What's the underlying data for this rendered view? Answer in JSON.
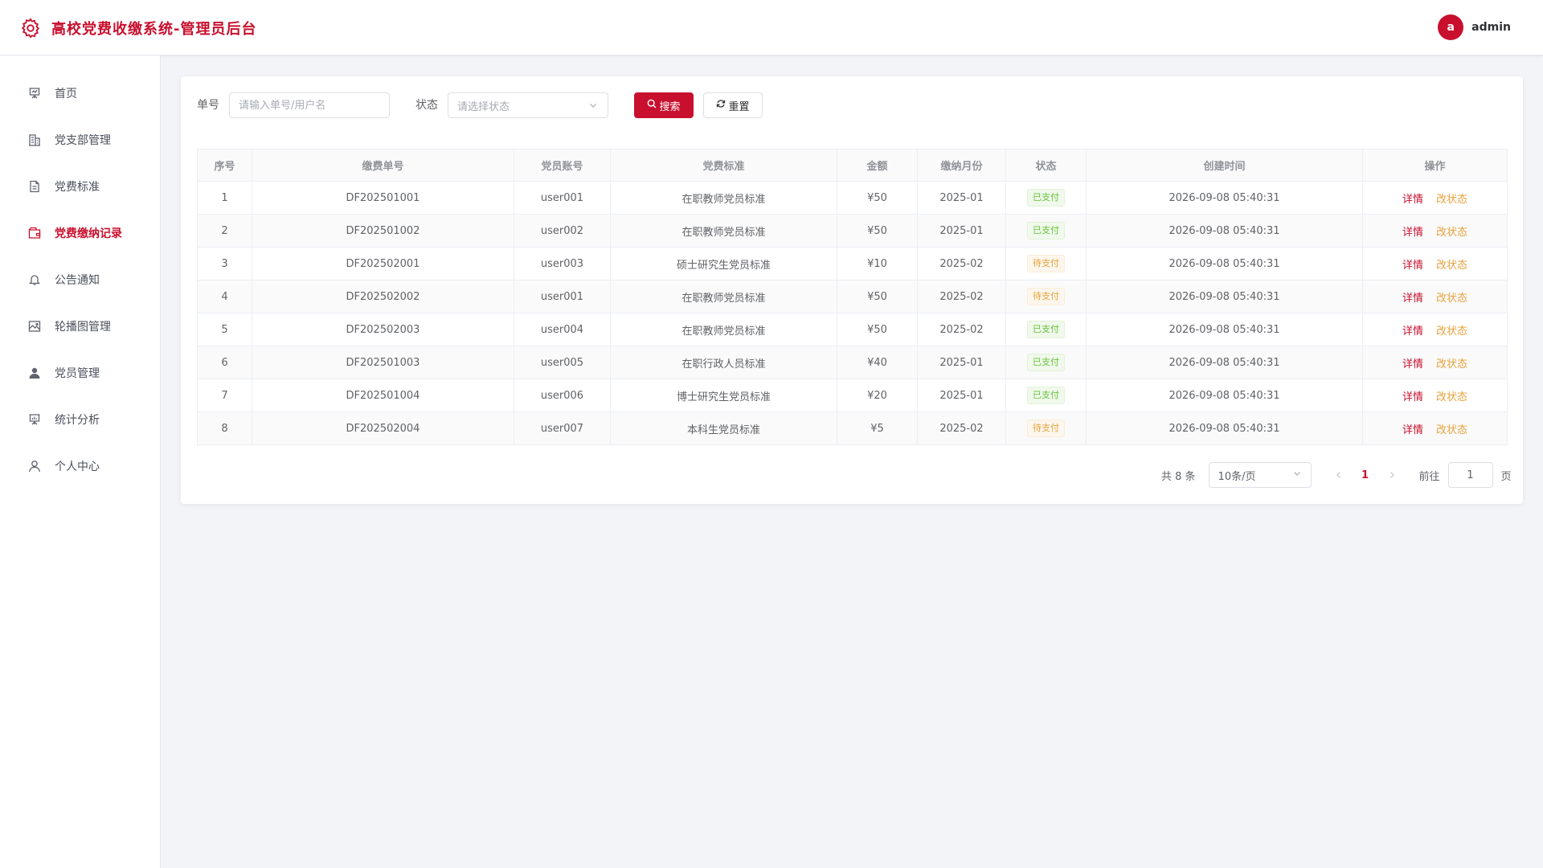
{
  "header": {
    "title": "高校党费收缴系统-管理员后台",
    "avatar_letter": "a",
    "username": "admin",
    "logo_icon": "gear-icon"
  },
  "sidebar": {
    "items": [
      {
        "label": "首页",
        "icon": "presentation-icon"
      },
      {
        "label": "党支部管理",
        "icon": "building-icon"
      },
      {
        "label": "党费标准",
        "icon": "document-icon"
      },
      {
        "label": "党费缴纳记录",
        "icon": "wallet-icon",
        "active": true
      },
      {
        "label": "公告通知",
        "icon": "bell-icon"
      },
      {
        "label": "轮播图管理",
        "icon": "picture-icon"
      },
      {
        "label": "党员管理",
        "icon": "user-filled-icon"
      },
      {
        "label": "统计分析",
        "icon": "chart-board-icon"
      },
      {
        "label": "个人中心",
        "icon": "user-icon"
      }
    ]
  },
  "filter": {
    "order_label": "单号",
    "order_placeholder": "请输入单号/用户名",
    "status_label": "状态",
    "status_placeholder": "请选择状态",
    "search_button": "搜索",
    "reset_button": "重置"
  },
  "table": {
    "headers": [
      "序号",
      "缴费单号",
      "党员账号",
      "党费标准",
      "金额",
      "缴纳月份",
      "状态",
      "创建时间",
      "操作"
    ],
    "rows": [
      {
        "no": "1",
        "order": "DF202501001",
        "account": "user001",
        "standard": "在职教师党员标准",
        "amount": "¥50",
        "month": "2025-01",
        "status": "已支付",
        "created": "2026-09-08 05:40:31"
      },
      {
        "no": "2",
        "order": "DF202501002",
        "account": "user002",
        "standard": "在职教师党员标准",
        "amount": "¥50",
        "month": "2025-01",
        "status": "已支付",
        "created": "2026-09-08 05:40:31"
      },
      {
        "no": "3",
        "order": "DF202502001",
        "account": "user003",
        "standard": "硕士研究生党员标准",
        "amount": "¥10",
        "month": "2025-02",
        "status": "待支付",
        "created": "2026-09-08 05:40:31"
      },
      {
        "no": "4",
        "order": "DF202502002",
        "account": "user001",
        "standard": "在职教师党员标准",
        "amount": "¥50",
        "month": "2025-02",
        "status": "待支付",
        "created": "2026-09-08 05:40:31"
      },
      {
        "no": "5",
        "order": "DF202502003",
        "account": "user004",
        "standard": "在职教师党员标准",
        "amount": "¥50",
        "month": "2025-02",
        "status": "已支付",
        "created": "2026-09-08 05:40:31"
      },
      {
        "no": "6",
        "order": "DF202501003",
        "account": "user005",
        "standard": "在职行政人员标准",
        "amount": "¥40",
        "month": "2025-01",
        "status": "已支付",
        "created": "2026-09-08 05:40:31"
      },
      {
        "no": "7",
        "order": "DF202501004",
        "account": "user006",
        "standard": "博士研究生党员标准",
        "amount": "¥20",
        "month": "2025-01",
        "status": "已支付",
        "created": "2026-09-08 05:40:31"
      },
      {
        "no": "8",
        "order": "DF202502004",
        "account": "user007",
        "standard": "本科生党员标准",
        "amount": "¥5",
        "month": "2025-02",
        "status": "待支付",
        "created": "2026-09-08 05:40:31"
      }
    ],
    "action_detail": "详情",
    "action_change_status": "改状态"
  },
  "pagination": {
    "total_text": "共 8 条",
    "page_size": "10条/页",
    "current_page": "1",
    "goto_label": "前往",
    "goto_value": "1",
    "page_suffix": "页"
  },
  "colors": {
    "brand": "#c8102e",
    "paid": "#67c23a",
    "pending": "#e6a23c"
  }
}
